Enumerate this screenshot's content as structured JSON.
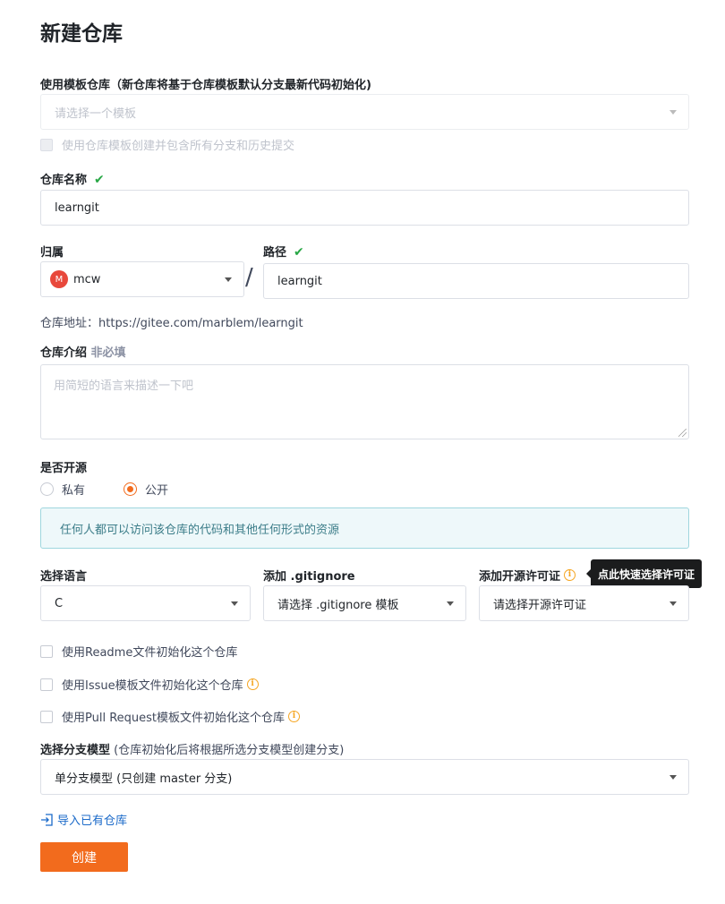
{
  "page": {
    "title": "新建仓库"
  },
  "template": {
    "label": "使用模板仓库（新仓库将基于仓库模板默认分支最新代码初始化)",
    "placeholder": "请选择一个模板",
    "include_branches_label": "使用仓库模板创建并包含所有分支和历史提交"
  },
  "repo_name": {
    "label": "仓库名称",
    "value": "learngit",
    "valid_icon": "check-icon"
  },
  "owner": {
    "label": "归属",
    "avatar_letter": "M",
    "value": "mcw"
  },
  "path": {
    "label": "路径",
    "separator": "/",
    "value": "learngit",
    "valid_icon": "check-icon"
  },
  "repo_url": {
    "label": "仓库地址：",
    "value": "https://gitee.com/marblem/learngit"
  },
  "description": {
    "label": "仓库介绍",
    "optional": "非必填",
    "placeholder": "用简短的语言来描述一下吧"
  },
  "visibility": {
    "label": "是否开源",
    "options": [
      {
        "label": "私有",
        "selected": false
      },
      {
        "label": "公开",
        "selected": true
      }
    ],
    "notice": "任何人都可以访问该仓库的代码和其他任何形式的资源"
  },
  "language": {
    "label": "选择语言",
    "value": "C"
  },
  "gitignore": {
    "label": "添加 .gitignore",
    "value": "请选择 .gitignore 模板"
  },
  "license": {
    "label": "添加开源许可证",
    "value": "请选择开源许可证",
    "tooltip": "点此快速选择许可证"
  },
  "init_options": [
    {
      "label": "使用Readme文件初始化这个仓库",
      "has_info": false
    },
    {
      "label": "使用Issue模板文件初始化这个仓库",
      "has_info": true
    },
    {
      "label": "使用Pull Request模板文件初始化这个仓库",
      "has_info": true
    }
  ],
  "branch_model": {
    "label": "选择分支模型",
    "hint": " (仓库初始化后将根据所选分支模型创建分支)",
    "value": "单分支模型 (只创建 master 分支)"
  },
  "import_link": {
    "label": "导入已有仓库"
  },
  "submit": {
    "label": "创建"
  },
  "colors": {
    "accent": "#f26b1d",
    "success": "#28a745",
    "info": "#f5a623",
    "link": "#1b6ac9"
  }
}
